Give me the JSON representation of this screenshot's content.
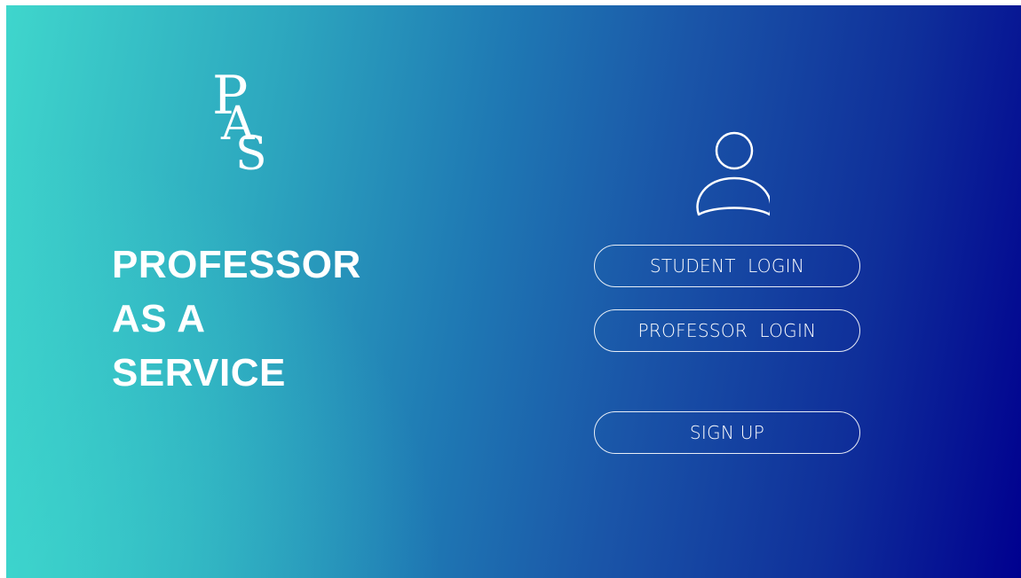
{
  "logo": {
    "letter1": "P",
    "letter2": "A",
    "letter3": "S"
  },
  "hero": {
    "line1": "PROFESSOR",
    "line2": "AS A",
    "line3": "SERVICE"
  },
  "auth": {
    "icon": "user-icon",
    "student_login_label": "STUDENT  LOGIN",
    "professor_login_label": "PROFESSOR  LOGIN",
    "sign_up_label": "SIGN UP"
  },
  "colors": {
    "gradient_start": "#3fd6cc",
    "gradient_end": "#00008f",
    "foreground": "#ffffff"
  }
}
